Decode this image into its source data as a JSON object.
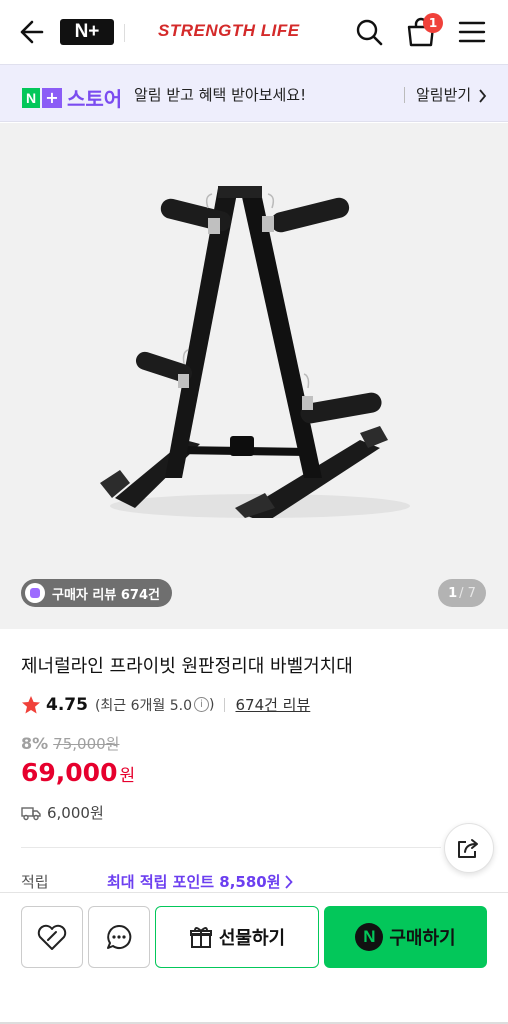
{
  "header": {
    "logo": "N+",
    "brand": "STRENGTH LIFE",
    "cart_count": "1"
  },
  "banner": {
    "store_n": "N",
    "store_plus": "+",
    "store_label": "스토어",
    "message": "알림 받고 혜택 받아보세요!",
    "cta": "알림받기"
  },
  "gallery": {
    "review_chip": "구매자 리뷰 674건",
    "current": "1",
    "total": "/ 7"
  },
  "product": {
    "title": "제너럴라인 프라이빗 원판정리대 바벨거치대",
    "rating": "4.75",
    "recent_rating": "(최근 6개월 5.0",
    "recent_close": ")",
    "info_icon": "i",
    "review_count": "674건 리뷰",
    "discount_rate": "8%",
    "original_price": "75,000원",
    "price": "69,000",
    "price_unit": "원",
    "shipping_fee": "6,000원"
  },
  "points": {
    "label": "적립",
    "value": "최대 적립 포인트 8,580원"
  },
  "actions": {
    "gift": "선물하기",
    "buy_n": "N",
    "buy": "구매하기"
  },
  "colors": {
    "brand_red": "#d42a2a",
    "naver_green": "#03c75a",
    "price_red": "#e6002d",
    "point_purple": "#6c3ff0"
  }
}
